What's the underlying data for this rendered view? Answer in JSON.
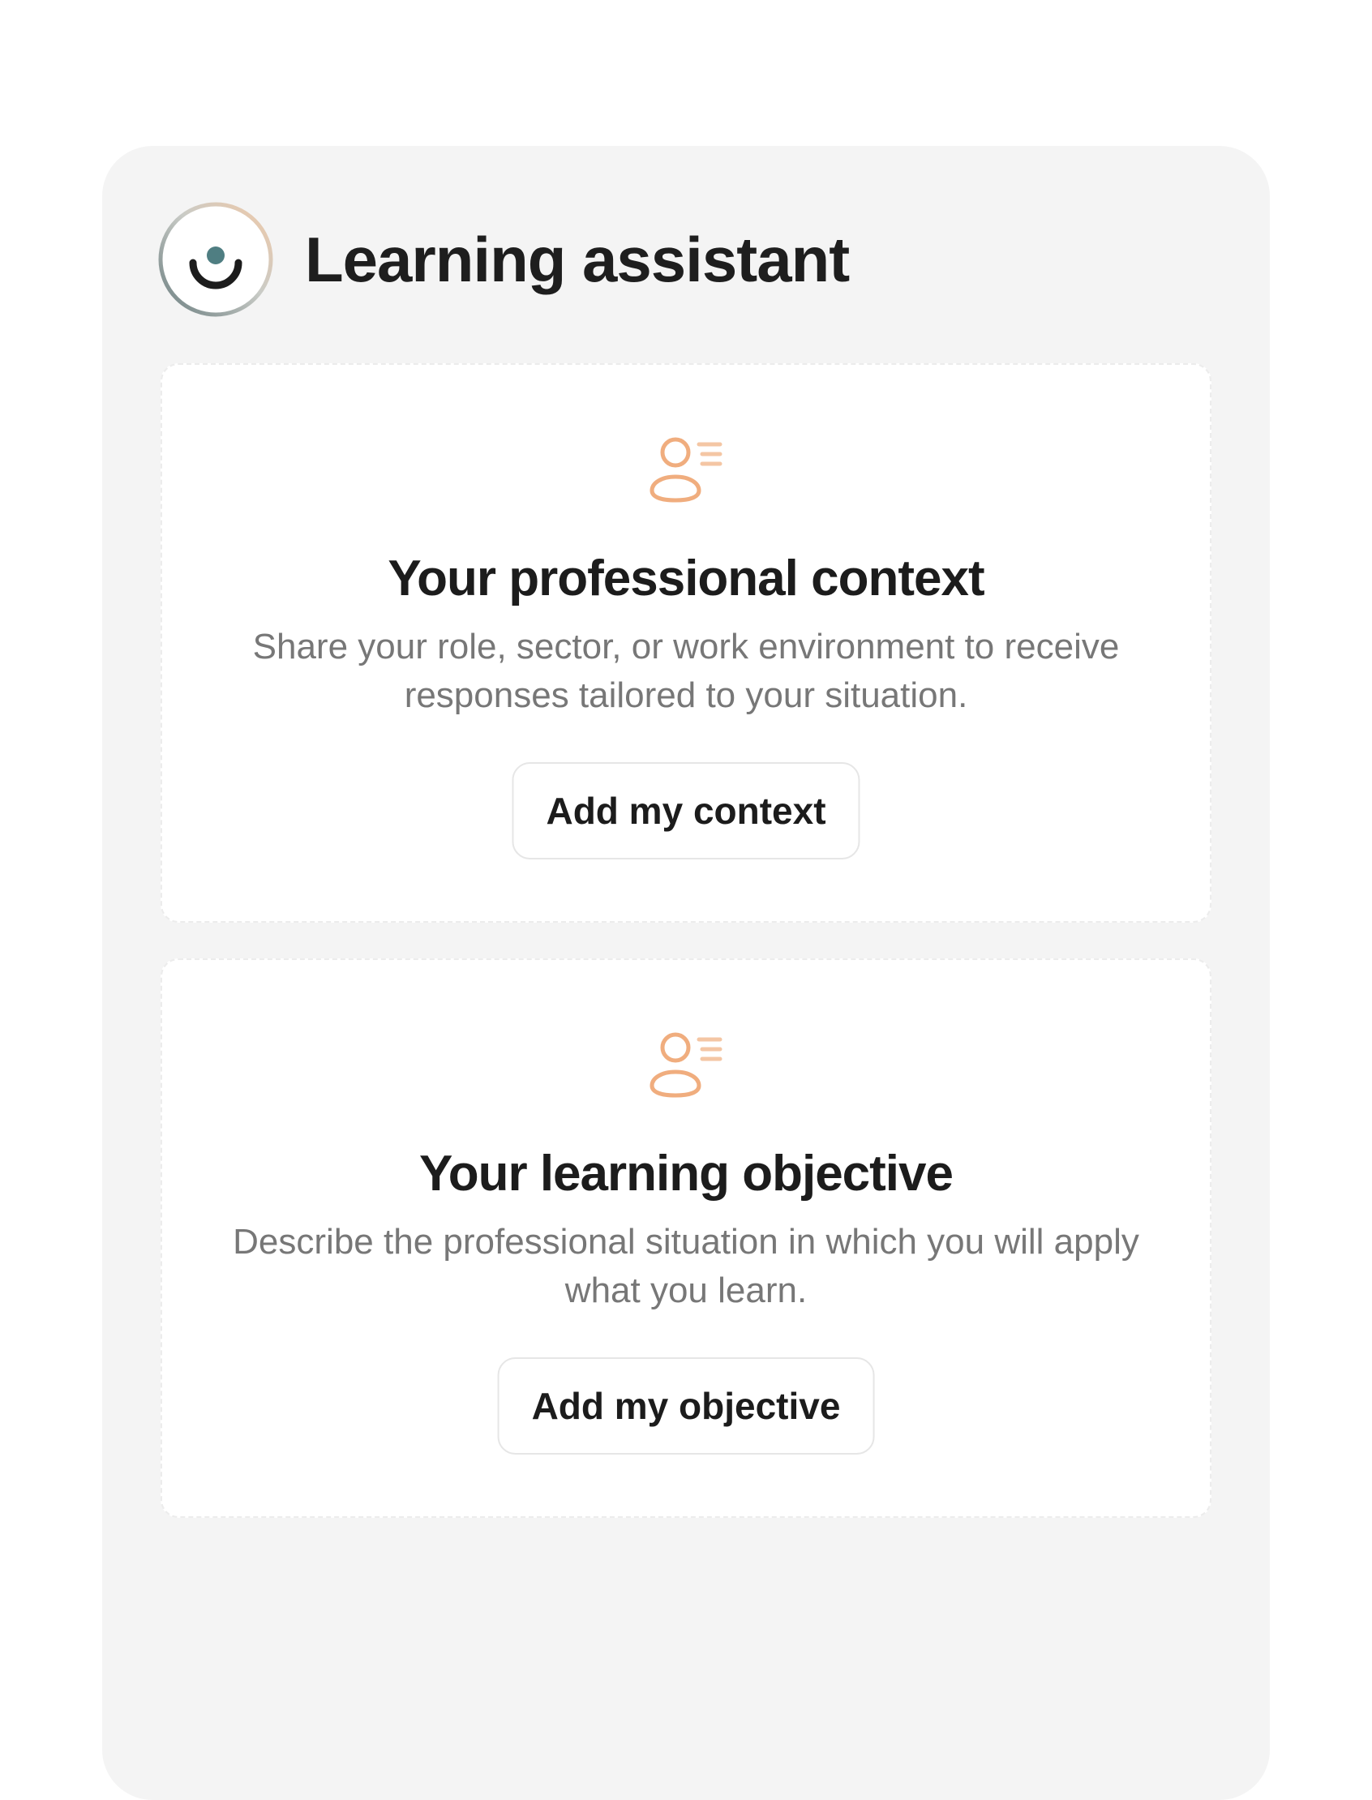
{
  "header": {
    "title": "Learning assistant",
    "logo_icon": "smile-eye-logo-icon"
  },
  "cards": [
    {
      "icon": "user-profile-list-icon",
      "title": "Your professional context",
      "description_lines": [
        "Share your role, sector, or work environment to receive",
        "responses tailored to your situation."
      ],
      "button_label": "Add my context"
    },
    {
      "icon": "user-profile-list-icon",
      "title": "Your learning objective",
      "description_lines": [
        "Describe the professional situation in which you will apply",
        "what you learn."
      ],
      "button_label": "Add my objective"
    }
  ],
  "colors": {
    "panel_background": "#f4f4f4",
    "card_background": "#ffffff",
    "icon_accent": "#f0ad7e",
    "logo_teal": "#4f7e82",
    "text_dark": "#1c1c1c",
    "text_muted": "#777777"
  }
}
